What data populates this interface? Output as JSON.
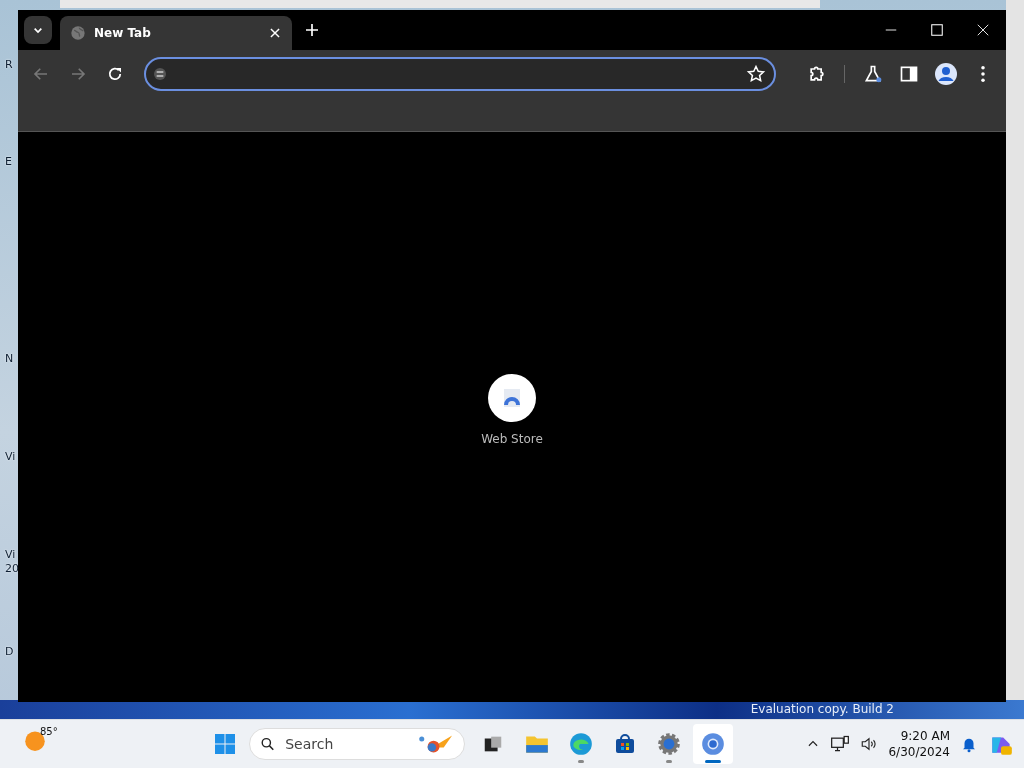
{
  "desktop": {
    "icon_labels": [
      {
        "text": "R"
      },
      {
        "text": "E"
      },
      {
        "text": "N"
      },
      {
        "text": "Vi"
      },
      {
        "text": "Vi"
      },
      {
        "text": "20"
      },
      {
        "text": "D"
      }
    ],
    "watermark": "Evaluation copy. Build 2"
  },
  "browser": {
    "tabs": [
      {
        "title": "New Tab",
        "selected": true
      }
    ],
    "shortcuts": [
      {
        "label": "Web Store"
      }
    ]
  },
  "taskbar": {
    "weather": "85°",
    "search": {
      "placeholder": "Search"
    },
    "apps": [
      {
        "kind": "taskview",
        "running": false,
        "selected": false
      },
      {
        "kind": "explorer",
        "running": false,
        "selected": false
      },
      {
        "kind": "edge",
        "running": true,
        "selected": false
      },
      {
        "kind": "store",
        "running": false,
        "selected": false
      },
      {
        "kind": "settings",
        "running": true,
        "selected": false
      },
      {
        "kind": "chrome",
        "running": true,
        "selected": true
      }
    ],
    "time": "9:20 AM",
    "date": "6/30/2024"
  }
}
